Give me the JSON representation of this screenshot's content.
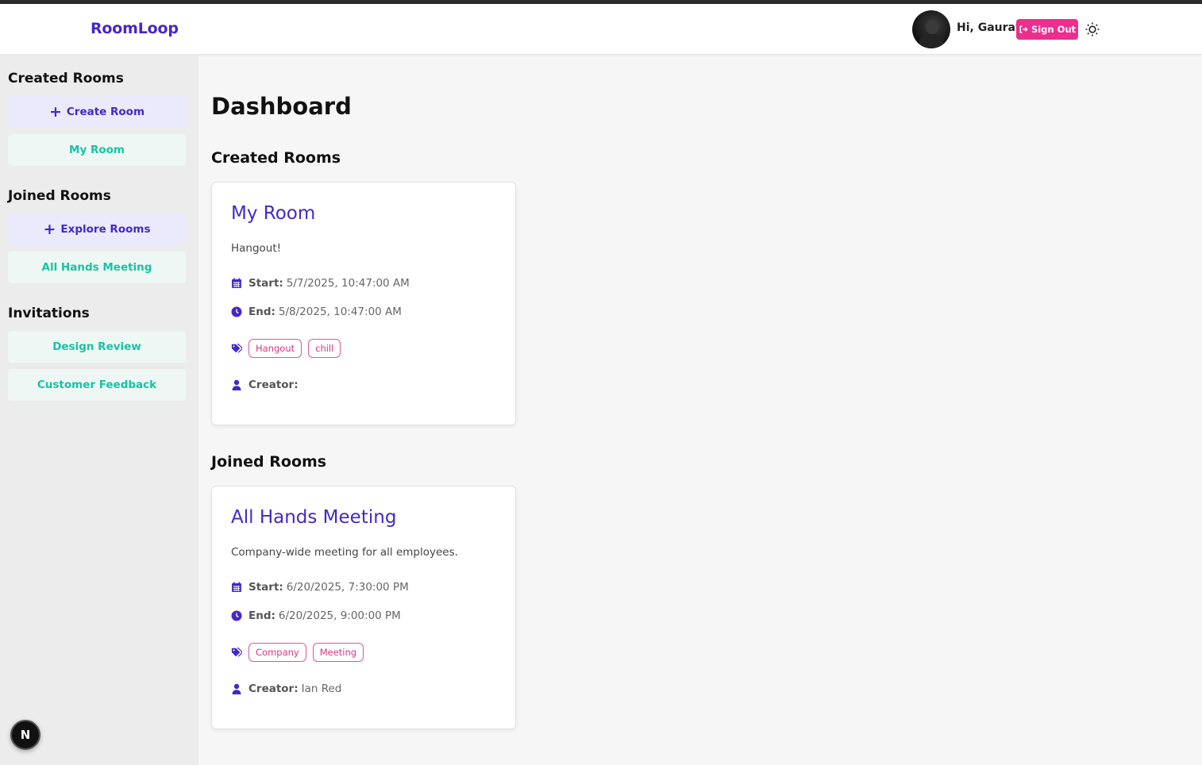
{
  "header": {
    "logo": "RoomLoop",
    "greeting": "Hi, Gaurav",
    "signout_label": "Sign Out",
    "accent": "#4527c9",
    "signout_color": "#ec2f8e"
  },
  "sidebar": {
    "created_title": "Created Rooms",
    "create_room_label": "Create Room",
    "created_rooms": [
      "My Room"
    ],
    "joined_title": "Joined Rooms",
    "explore_label": "Explore Rooms",
    "joined_rooms": [
      "All Hands Meeting"
    ],
    "invitations_title": "Invitations",
    "invitations": [
      "Design Review",
      "Customer Feedback"
    ]
  },
  "main": {
    "title": "Dashboard",
    "created_section": "Created Rooms",
    "joined_section": "Joined Rooms",
    "created_card": {
      "title": "My Room",
      "description": "Hangout!",
      "start_label": "Start:",
      "start": "5/7/2025, 10:47:00 AM",
      "end_label": "End:",
      "end": "5/8/2025, 10:47:00 AM",
      "tags": [
        "Hangout",
        "chill"
      ],
      "creator_label": "Creator:",
      "creator": ""
    },
    "joined_card": {
      "title": "All Hands Meeting",
      "description": "Company-wide meeting for all employees.",
      "start_label": "Start:",
      "start": "6/20/2025, 7:30:00 PM",
      "end_label": "End:",
      "end": "6/20/2025, 9:00:00 PM",
      "tags": [
        "Company",
        "Meeting"
      ],
      "creator_label": "Creator:",
      "creator": "Ian Red"
    }
  },
  "dev_badge": "N"
}
